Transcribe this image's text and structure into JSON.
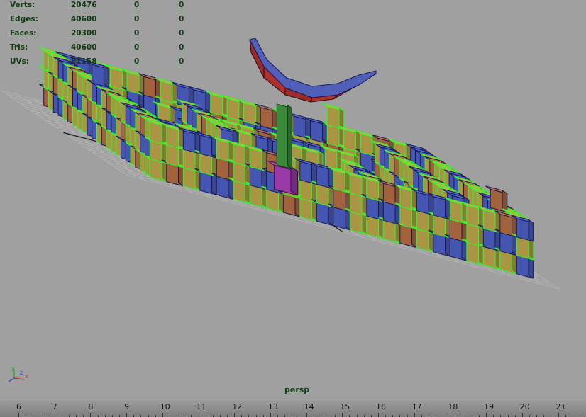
{
  "hud": {
    "rows": [
      {
        "label": "Verts:",
        "v1": "20476",
        "v2": "0",
        "v3": "0"
      },
      {
        "label": "Edges:",
        "v1": "40600",
        "v2": "0",
        "v3": "0"
      },
      {
        "label": "Faces:",
        "v1": "20300",
        "v2": "0",
        "v3": "0"
      },
      {
        "label": "Tris:",
        "v1": "40600",
        "v2": "0",
        "v3": "0"
      },
      {
        "label": "UVs:",
        "v1": "21158",
        "v2": "0",
        "v3": "0"
      }
    ]
  },
  "viewport": {
    "camera": "persp",
    "background_color": "#a0a0a0",
    "wireframe_highlight_color": "#22ff22"
  },
  "axes": {
    "x": "x",
    "y": "y",
    "z": "z"
  },
  "timeline": {
    "ticks": [
      "6",
      "7",
      "8",
      "9",
      "10",
      "11",
      "12",
      "13",
      "14",
      "15",
      "16",
      "17",
      "18",
      "19",
      "20",
      "21"
    ]
  },
  "colors": {
    "yellow_block": "#b8a24a",
    "blue_block": "#4a5ec0",
    "orange_block": "#b06a40",
    "crescent": "#b03030",
    "pillar": "#3a8a3a",
    "base": "#9a3aa8"
  }
}
